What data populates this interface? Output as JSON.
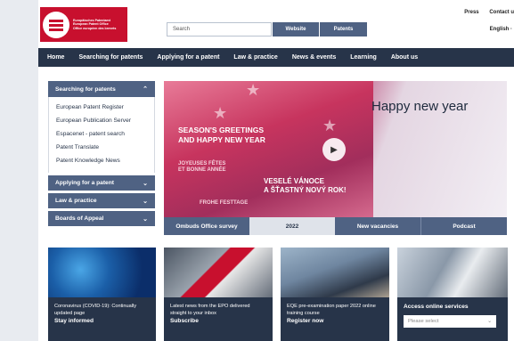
{
  "header": {
    "logo_lines": [
      "Europäisches Patentamt",
      "European Patent Office",
      "Office européen des brevets"
    ],
    "search_placeholder": "Search",
    "website_btn": "Website",
    "patents_btn": "Patents",
    "top_links": [
      "Press",
      "Contact u"
    ],
    "language": "English ·"
  },
  "nav": [
    "Home",
    "Searching for patents",
    "Applying for a patent",
    "Law & practice",
    "News & events",
    "Learning",
    "About us"
  ],
  "sidebar": {
    "title": "Searching for patents",
    "links": [
      "European Patent Register",
      "European Publication Server",
      "Espacenet - patent search",
      "Patent Translate",
      "Patent Knowledge News"
    ],
    "sections": [
      "Applying for a patent",
      "Law & practice",
      "Boards of Appeal"
    ]
  },
  "hero": {
    "title": "Happy new year",
    "greetings": [
      "SEASON'S GREETINGS",
      "AND HAPPY NEW YEAR",
      "JOYEUSES FÊTES",
      "ET BONNE ANNÉE",
      "FROHE FESTTAGE",
      "VESELÉ VÁNOCE",
      "A ŠŤASTNÝ NOVÝ ROK!"
    ],
    "tabs": [
      "Ombuds Office survey",
      "2022",
      "New vacancies",
      "Podcast"
    ]
  },
  "cards": [
    {
      "small": "Coronavirus (COVID-19): Continually updated page",
      "bold": "Stay informed"
    },
    {
      "small": "Latest news from the EPO delivered straight to your inbox",
      "bold": "Subscribe"
    },
    {
      "small": "EQE pre-examination paper 2022 online training course",
      "bold": "Register now"
    },
    {
      "title": "Access online services",
      "select": "Please select"
    }
  ],
  "colors": {
    "brand_red": "#c8102e",
    "navy": "#273449",
    "slate": "#4f6283"
  }
}
